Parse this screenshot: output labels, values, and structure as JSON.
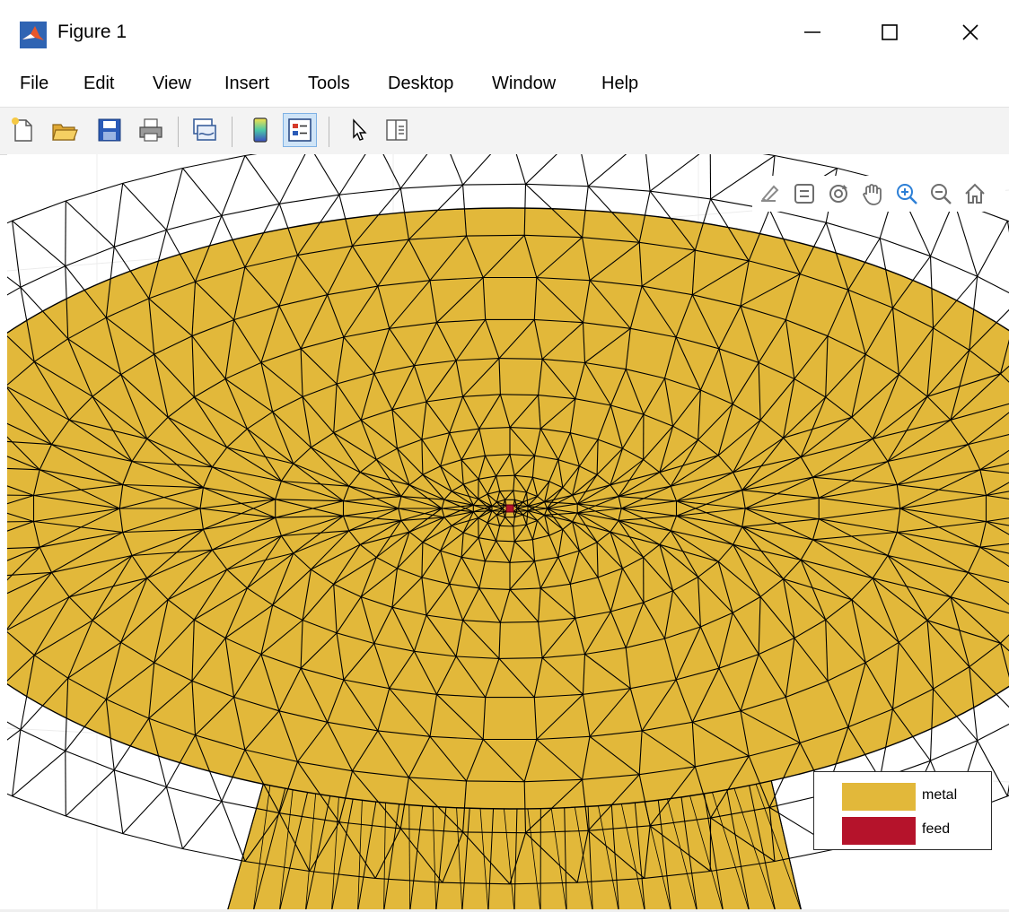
{
  "window": {
    "title": "Figure 1",
    "controls": [
      "minimize-icon",
      "maximize-icon",
      "close-icon"
    ]
  },
  "menu": {
    "items": [
      "File",
      "Edit",
      "View",
      "Insert",
      "Tools",
      "Desktop",
      "Window",
      "Help"
    ]
  },
  "toolbar": {
    "buttons": [
      "new-figure-icon",
      "open-file-icon",
      "save-icon",
      "print-icon",
      "link-plot-icon",
      "colorbar-icon",
      "legend-icon",
      "edit-plot-icon",
      "property-inspector-icon"
    ],
    "toggled": "legend-icon"
  },
  "axes_toolbar": {
    "buttons": [
      "export-icon",
      "brush-icon",
      "rotate-3d-icon",
      "pan-icon",
      "zoom-in-icon",
      "zoom-out-icon",
      "home-icon"
    ],
    "active": "zoom-in-icon"
  },
  "legend": {
    "entries": [
      {
        "label": "metal",
        "color": "#e2b83a"
      },
      {
        "label": "feed",
        "color": "#b5132b"
      }
    ]
  },
  "colors": {
    "metal": "#e2b83a",
    "feed": "#b5132b",
    "mesh_edge": "#000000",
    "toolbar_bg": "#f3f3f3"
  }
}
